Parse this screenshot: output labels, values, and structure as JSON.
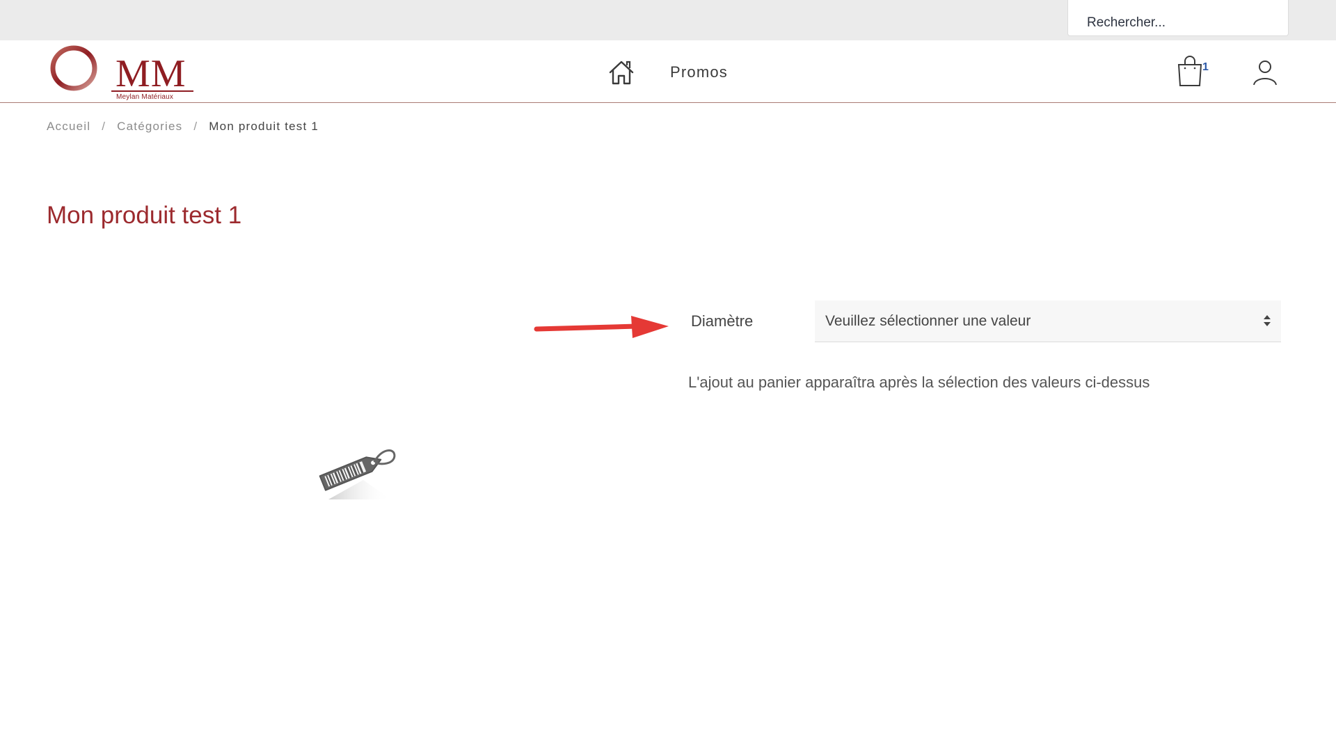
{
  "search": {
    "placeholder": "Rechercher..."
  },
  "header": {
    "logo_text": "MM",
    "logo_subtitle": "Meylan  Matériaux",
    "nav_promos": "Promos",
    "cart_count": "1"
  },
  "breadcrumb": {
    "items": [
      "Accueil",
      "Catégories",
      "Mon produit test 1"
    ],
    "separator": "/"
  },
  "product": {
    "title": "Mon produit test 1",
    "variant_label": "Diamètre",
    "variant_placeholder": "Veuillez sélectionner une valeur",
    "notice": "L'ajout au panier apparaîtra après la sélection des valeurs ci-dessus"
  },
  "colors": {
    "brand": "#8f1d22",
    "title": "#9c2a2e",
    "annotation_arrow": "#e53935",
    "cart_badge": "#2e5aa7"
  },
  "icons": {
    "home": "home-icon",
    "cart": "shopping-bag-icon",
    "account": "user-icon",
    "product": "price-tag-barcode-icon"
  }
}
